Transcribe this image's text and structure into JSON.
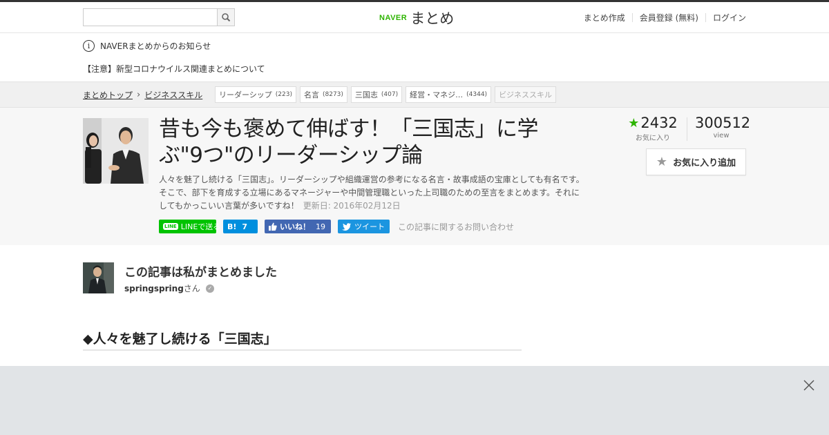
{
  "header": {
    "search_placeholder": "",
    "logo_naver": "NAVER",
    "logo_matome": "まとめ",
    "nav": [
      "まとめ作成",
      "会員登録 (無料)",
      "ログイン"
    ]
  },
  "notice": {
    "title": "NAVERまとめからのお知らせ",
    "link": "【注意】新型コロナウイルス関連まとめについて"
  },
  "breadcrumb": {
    "items": [
      "まとめトップ",
      "ビジネススキル"
    ],
    "tags": [
      {
        "label": "リーダーシップ",
        "count": "(223)"
      },
      {
        "label": "名言",
        "count": "(8273)"
      },
      {
        "label": "三国志",
        "count": "(407)"
      },
      {
        "label": "経営・マネジ…",
        "count": "(4344)"
      },
      {
        "label": "ビジネススキル",
        "count": ""
      }
    ]
  },
  "article": {
    "title": "昔も今も褒めて伸ばす！「三国志」に学ぶ\"9つ\"のリーダーシップ論",
    "description": "人々を魅了し続ける「三国志」。リーダーシップや組織運営の参考になる名言・故事成語の宝庫としても有名です。そこで、部下を育成する立場にあるマネージャーや中間管理職といった上司職のための至言をまとめます。それにしてもかっこいい言葉が多いですね！",
    "updated": "更新日: 2016年02月12日",
    "favorites": "2432",
    "favorites_label": "お気に入り",
    "views": "300512",
    "views_label": "view",
    "fav_button": "お気に入り追加",
    "share": {
      "line": "LINEで送る",
      "line_badge": "LINE",
      "hatena_logo": "B!",
      "hatena_count": "7",
      "fb_label": "いいね！",
      "fb_count": "19",
      "tweet": "ツイート",
      "contact": "この記事に関するお問い合わせ"
    }
  },
  "author": {
    "heading": "この記事は私がまとめました",
    "name": "springspring",
    "suffix": "さん"
  },
  "section": {
    "heading": "◆人々を魅了し続ける「三国志」"
  },
  "icons": {
    "search": "magnifier",
    "info": "info-circle",
    "star": "star",
    "close": "x"
  },
  "colors": {
    "brand_green": "#2db400",
    "line_green": "#00c300",
    "hatena_blue": "#008fde",
    "facebook_blue": "#4267b2",
    "twitter_blue": "#1b95e0"
  }
}
